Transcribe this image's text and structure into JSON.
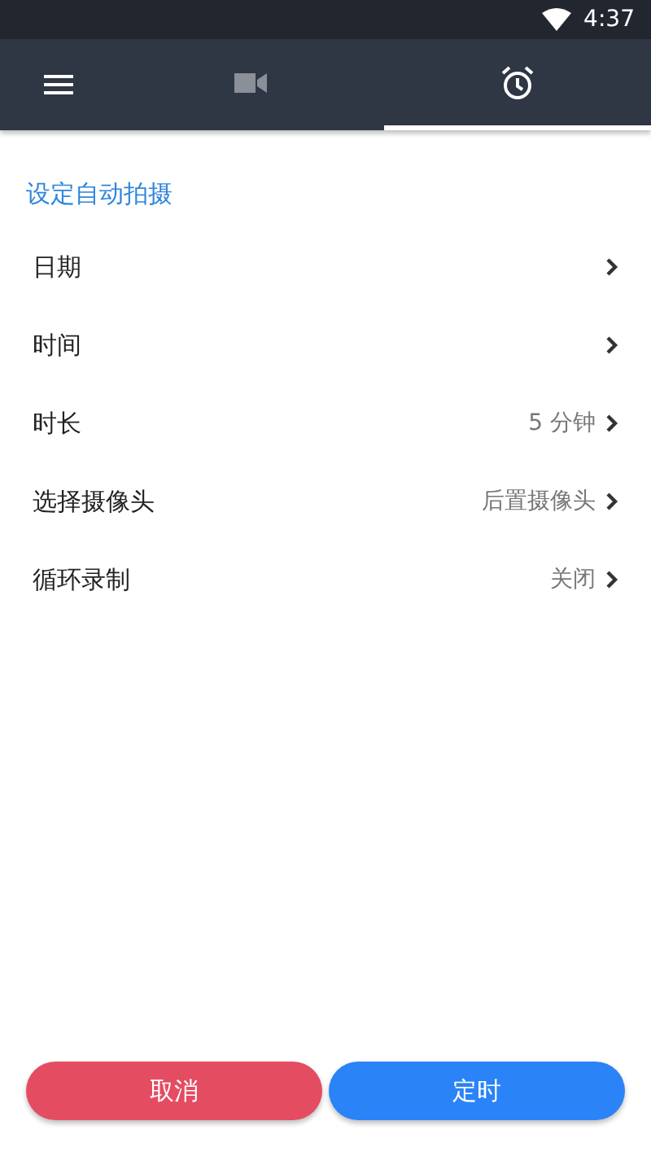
{
  "status_bar": {
    "time": "4:37"
  },
  "tabs": [
    {
      "kind": "video",
      "selected": false
    },
    {
      "kind": "alarm",
      "selected": true
    }
  ],
  "section_title": "设定自动拍摄",
  "settings": [
    {
      "label": "日期"
    },
    {
      "label": "时间"
    },
    {
      "label": "时长",
      "value": "5 分钟"
    },
    {
      "label": "选择摄像头",
      "value": "后置摄像头"
    },
    {
      "label": "循环录制",
      "value": "关闭"
    }
  ],
  "buttons": [
    {
      "label": "取消",
      "kind": "cancel"
    },
    {
      "label": "定时",
      "kind": "confirm"
    }
  ]
}
